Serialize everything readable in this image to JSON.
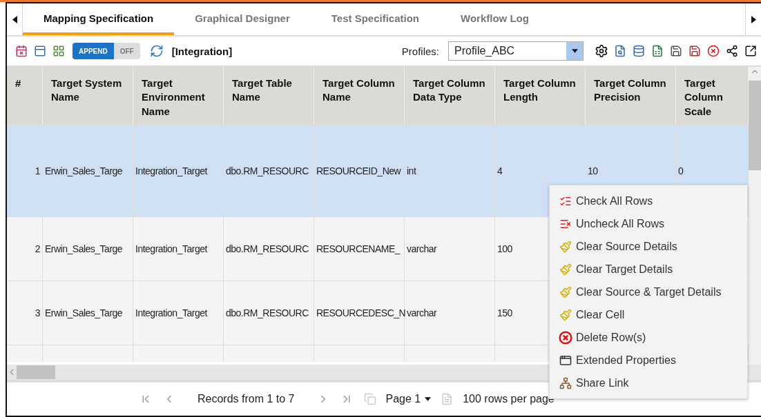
{
  "tabs": [
    {
      "label": "Mapping Specification",
      "selected": true
    },
    {
      "label": "Graphical Designer",
      "selected": false
    },
    {
      "label": "Test Specification",
      "selected": false
    },
    {
      "label": "Workflow Log",
      "selected": false
    }
  ],
  "toolbar": {
    "toggle": {
      "on_label": "APPEND",
      "off_label": "OFF"
    },
    "context": "[Integration]",
    "profiles_label": "Profiles:",
    "profile": "Profile_ABC"
  },
  "table": {
    "columns": [
      "#",
      "Target System Name",
      "Target Environment Name",
      "Target Table Name",
      "Target Column Name",
      "Target Column Data Type",
      "Target Column Length",
      "Target Column Precision",
      "Target Column Scale"
    ],
    "rows": [
      {
        "selected": true,
        "cells": [
          "1",
          "Erwin_Sales_Targe",
          "Integration_Target",
          "dbo.RM_RESOURC",
          "RESOURCEID_New",
          "int",
          "4",
          "10",
          "0"
        ]
      },
      {
        "selected": false,
        "cells": [
          "2",
          "Erwin_Sales_Targe",
          "Integration_Target",
          "dbo.RM_RESOURC",
          "RESOURCENAME_",
          "varchar",
          "100"
        ]
      },
      {
        "selected": false,
        "cells": [
          "3",
          "Erwin_Sales_Targe",
          "Integration_Target",
          "dbo.RM_RESOURC",
          "RESOURCEDESC_N",
          "varchar",
          "150"
        ]
      }
    ]
  },
  "pager": {
    "records": "Records from 1 to 7",
    "page": "Page 1",
    "rows_per_page": "100 rows per page"
  },
  "context_menu": [
    {
      "kind": "check",
      "label": "Check All Rows"
    },
    {
      "kind": "uncheck",
      "label": "Uncheck All Rows"
    },
    {
      "kind": "clear",
      "label": "Clear Source Details"
    },
    {
      "kind": "clear",
      "label": "Clear Target Details"
    },
    {
      "kind": "clear",
      "label": "Clear Source & Target Details"
    },
    {
      "kind": "clear",
      "label": "Clear Cell"
    },
    {
      "kind": "delete",
      "label": "Delete Row(s)"
    },
    {
      "kind": "properties",
      "label": "Extended Properties"
    },
    {
      "kind": "share",
      "label": "Share Link"
    }
  ]
}
